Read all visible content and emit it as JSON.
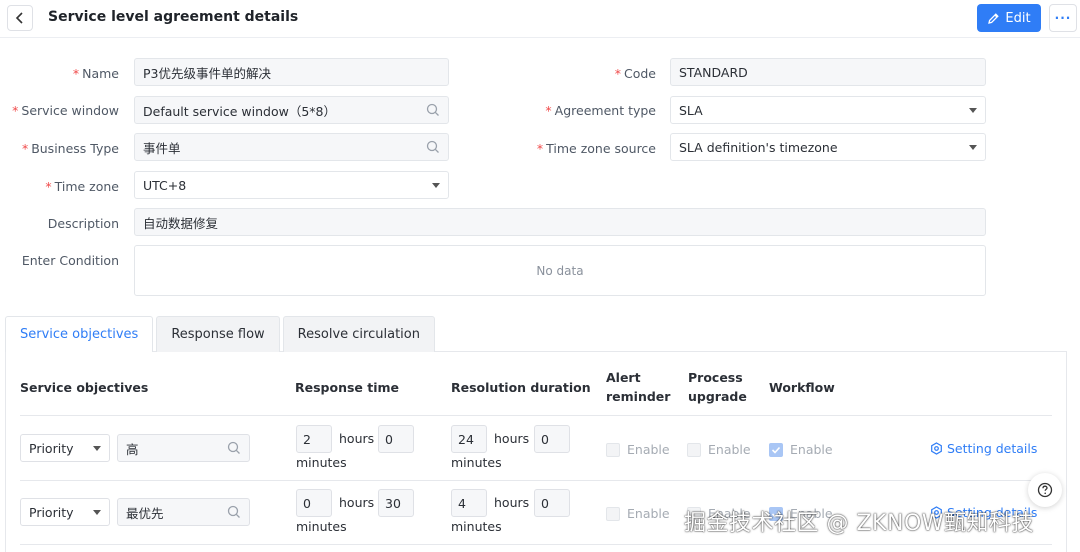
{
  "header": {
    "title": "Service level agreement details",
    "edit_label": "Edit",
    "more_label": "···"
  },
  "form": {
    "name": {
      "label": "Name",
      "value": "P3优先级事件单的解决"
    },
    "code": {
      "label": "Code",
      "value": "STANDARD"
    },
    "service_window": {
      "label": "Service window",
      "value": "Default service window（5*8）"
    },
    "agreement_type": {
      "label": "Agreement type",
      "value": "SLA"
    },
    "business_type": {
      "label": "Business Type",
      "value": "事件单"
    },
    "time_zone_source": {
      "label": "Time zone source",
      "value": "SLA definition's timezone"
    },
    "time_zone": {
      "label": "Time zone",
      "value": "UTC+8"
    },
    "description": {
      "label": "Description",
      "value": "自动数据修复"
    },
    "enter_condition": {
      "label": "Enter Condition",
      "empty_text": "No data"
    },
    "required_mark": "*"
  },
  "tabs": [
    {
      "label": "Service objectives",
      "active": true
    },
    {
      "label": "Response flow",
      "active": false
    },
    {
      "label": "Resolve circulation",
      "active": false
    }
  ],
  "table": {
    "headers": {
      "objectives": "Service objectives",
      "response_time": "Response time",
      "resolution_duration": "Resolution duration",
      "alert_reminder": "Alert reminder",
      "process_upgrade": "Process upgrade",
      "workflow": "Workflow"
    },
    "units": {
      "hours": "hours",
      "minutes": "minutes"
    },
    "enable_label": "Enable",
    "rows": [
      {
        "type": "Priority",
        "value": "高",
        "response_hours": "2",
        "response_minutes": "0",
        "resolution_hours": "24",
        "resolution_minutes": "0",
        "alert": false,
        "upgrade": false,
        "workflow": true,
        "action": "Setting details"
      },
      {
        "type": "Priority",
        "value": "最优先",
        "response_hours": "0",
        "response_minutes": "30",
        "resolution_hours": "4",
        "resolution_minutes": "0",
        "alert": false,
        "upgrade": false,
        "workflow": true,
        "action": "Setting details"
      }
    ]
  },
  "watermark": "掘金技术社区 @ ZKNOW甄知科技",
  "colors": {
    "primary": "#2f7df6",
    "required": "#f04a4a"
  }
}
